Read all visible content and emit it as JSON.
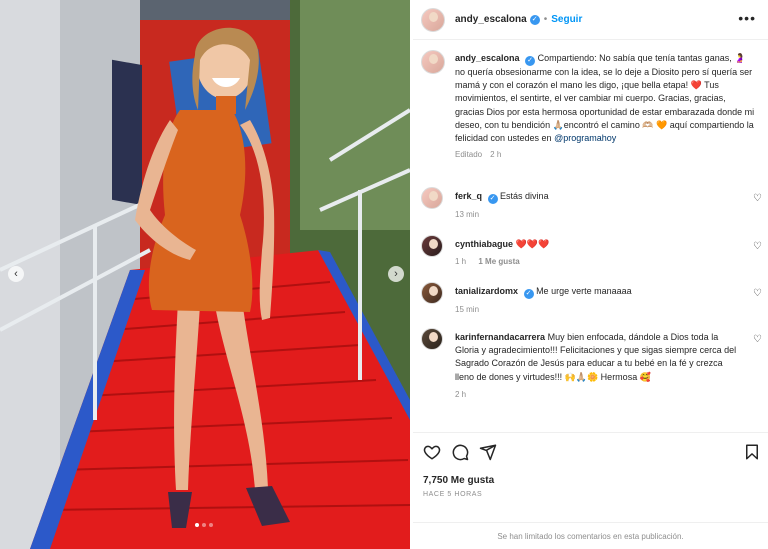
{
  "post": {
    "username": "andy_escalona",
    "follow_label": "Seguir",
    "separator": "•"
  },
  "caption": {
    "username": "andy_escalona",
    "text": "Compartiendo: No sabía que tenía tantas ganas, 🤰 no quería obsesionarme con la idea, se lo deje a Diosito pero sí quería ser mamá y con el corazón el mano les digo, ¡que bella etapa! ❤️ Tus movimientos, el sentirte, el ver cambiar mi cuerpo. Gracias, gracias, gracias Dios por esta hermosa oportunidad de estar embarazada donde mi deseo, con tu bendición 🙏🏼encontró el camino 🫶🏼 🧡 aquí compartiendo la felicidad con ustedes en",
    "mention": "@programahoy",
    "edited": "Editado",
    "time": "2 h"
  },
  "comments": [
    {
      "username": "ferk_q",
      "verified": true,
      "text": "Estás divina",
      "time": "13 min",
      "likes": ""
    },
    {
      "username": "cynthiabague",
      "verified": false,
      "text": "❤️❤️❤️",
      "time": "1 h",
      "likes": "1 Me gusta"
    },
    {
      "username": "tanializardomx",
      "verified": true,
      "text": "Me urge verte manaaaa",
      "time": "15 min",
      "likes": ""
    },
    {
      "username": "karinfernandacarrera",
      "verified": false,
      "text": "Muy bien enfocada, dándole a Dios toda la Gloria y agradecimiento!!! Felicitaciones y que sigas siempre cerca del Sagrado Corazón de Jesús para educar a tu bebé en la fé y crezca lleno de dones y virtudes!!! 🙌🙏🏼🌼 Hermosa 🥰",
      "time": "2 h",
      "likes": ""
    }
  ],
  "actions": {
    "likes_count": "7,750 Me gusta",
    "time_ago": "HACE 5 HORAS",
    "comments_limited": "Se han limitado los comentarios en esta publicación."
  },
  "colors": {
    "accent_blue": "#0095f6",
    "verified_blue": "#3897f0",
    "dress_orange": "#d9641e",
    "stairs_red": "#e01b1b"
  },
  "icons": {
    "like": "heart-icon",
    "comment": "comment-bubble-icon",
    "share": "paper-plane-icon",
    "save": "bookmark-icon",
    "more": "more-options-icon"
  },
  "carousel": {
    "current": 1,
    "total": 3
  }
}
